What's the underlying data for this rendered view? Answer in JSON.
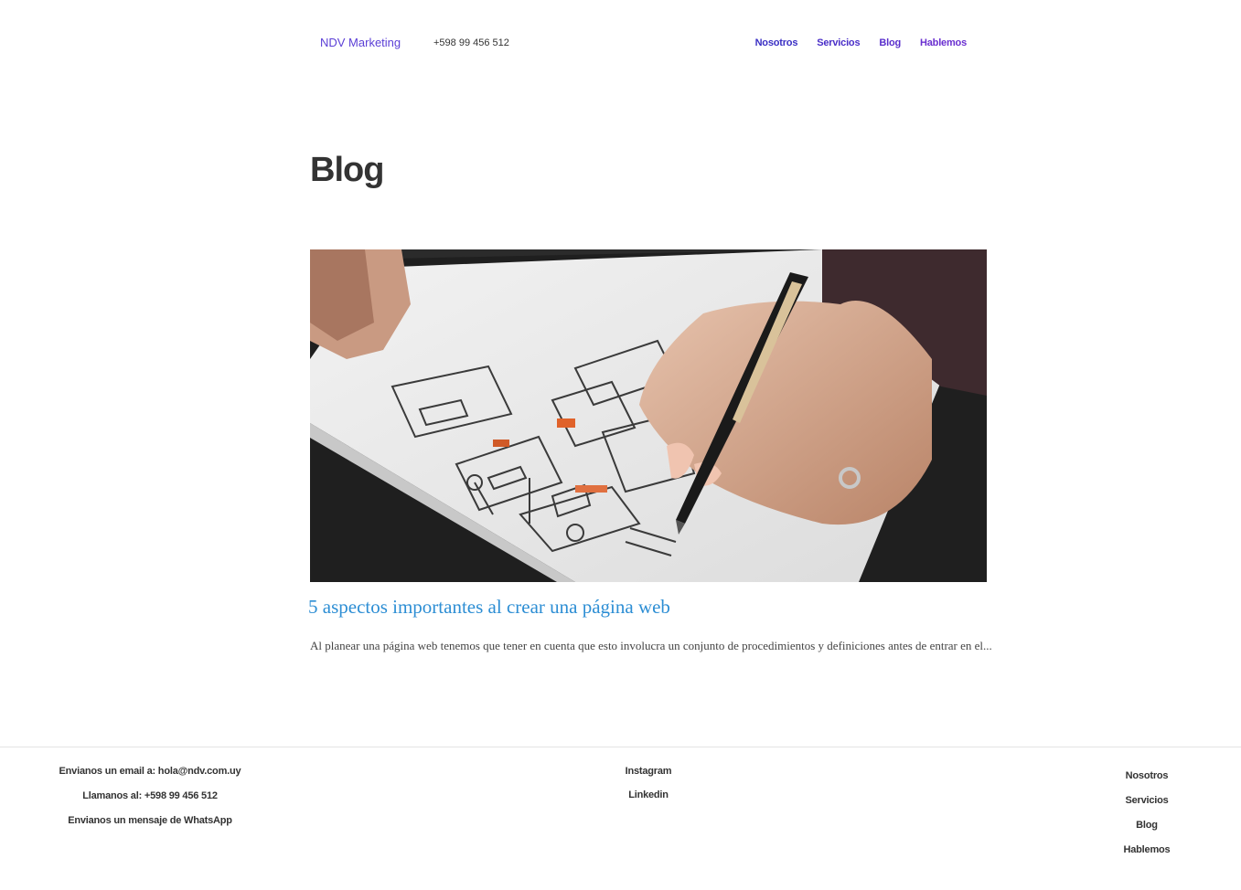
{
  "header": {
    "brand": "NDV Marketing",
    "phone": "+598 99 456 512",
    "nav": [
      "Nosotros",
      "Servicios",
      "Blog",
      "Hablemos"
    ]
  },
  "page": {
    "title": "Blog"
  },
  "post": {
    "image_icon": "wireframe-sketch-photo",
    "title": "5 aspectos importantes al crear una página web",
    "excerpt": "Al planear una página web tenemos que tener en cuenta que esto involucra un conjunto de procedimientos y definiciones antes de entrar en el..."
  },
  "footer": {
    "contact": [
      "Envianos un email a: hola@ndv.com.uy",
      "Llamanos al: +598 99 456 512",
      "Envianos un mensaje de WhatsApp"
    ],
    "social": [
      "Instagram",
      "Linkedin"
    ],
    "nav": [
      "Nosotros",
      "Servicios",
      "Blog",
      "Hablemos"
    ]
  },
  "colors": {
    "brand": "#5b3fd6",
    "post_title": "#2d8ed4",
    "text": "#333333"
  }
}
